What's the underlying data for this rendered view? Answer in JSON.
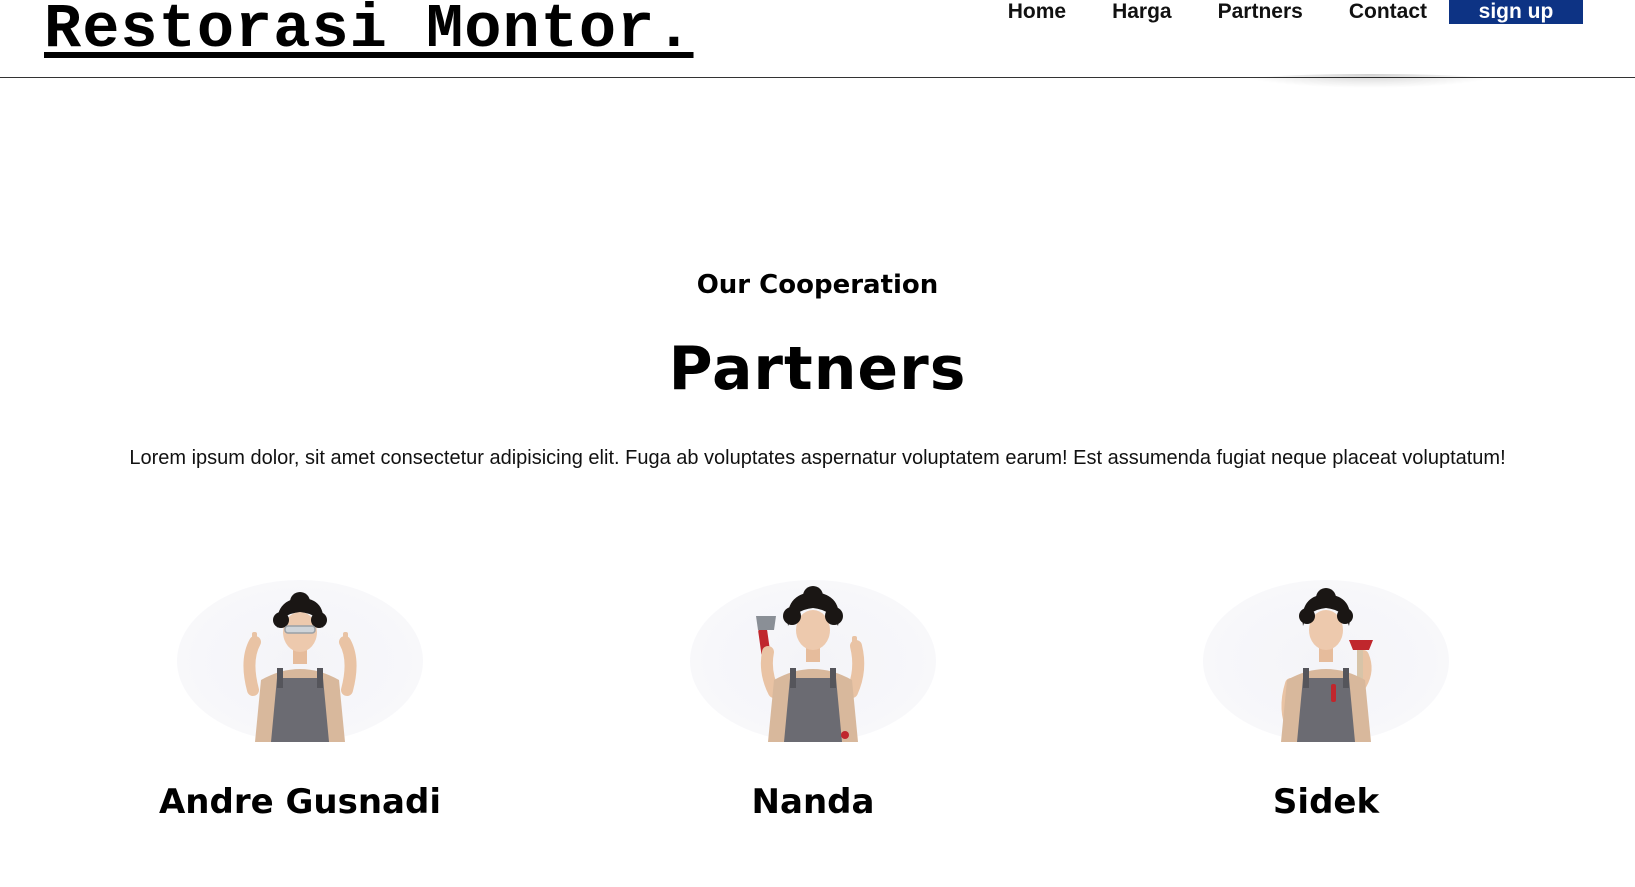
{
  "header": {
    "logo": "Restorasi Montor.",
    "nav": [
      {
        "label": "Home"
      },
      {
        "label": "Harga"
      },
      {
        "label": "Partners"
      },
      {
        "label": "Contact"
      }
    ],
    "signup_label": "sign up",
    "signup_color": "#0d3384"
  },
  "partners_section": {
    "subtitle": "Our Cooperation",
    "title": "Partners",
    "description": "Lorem ipsum dolor, sit amet consectetur adipisicing elit. Fuga ab voluptates aspernatur voluptatem earum! Est assumenda fugiat neque placeat voluptatum!",
    "partners": [
      {
        "name": "Andre Gusnadi",
        "pose": "pointing-up-with-glasses"
      },
      {
        "name": "Nanda",
        "pose": "holding-wrench"
      },
      {
        "name": "Sidek",
        "pose": "holding-tools"
      }
    ]
  }
}
